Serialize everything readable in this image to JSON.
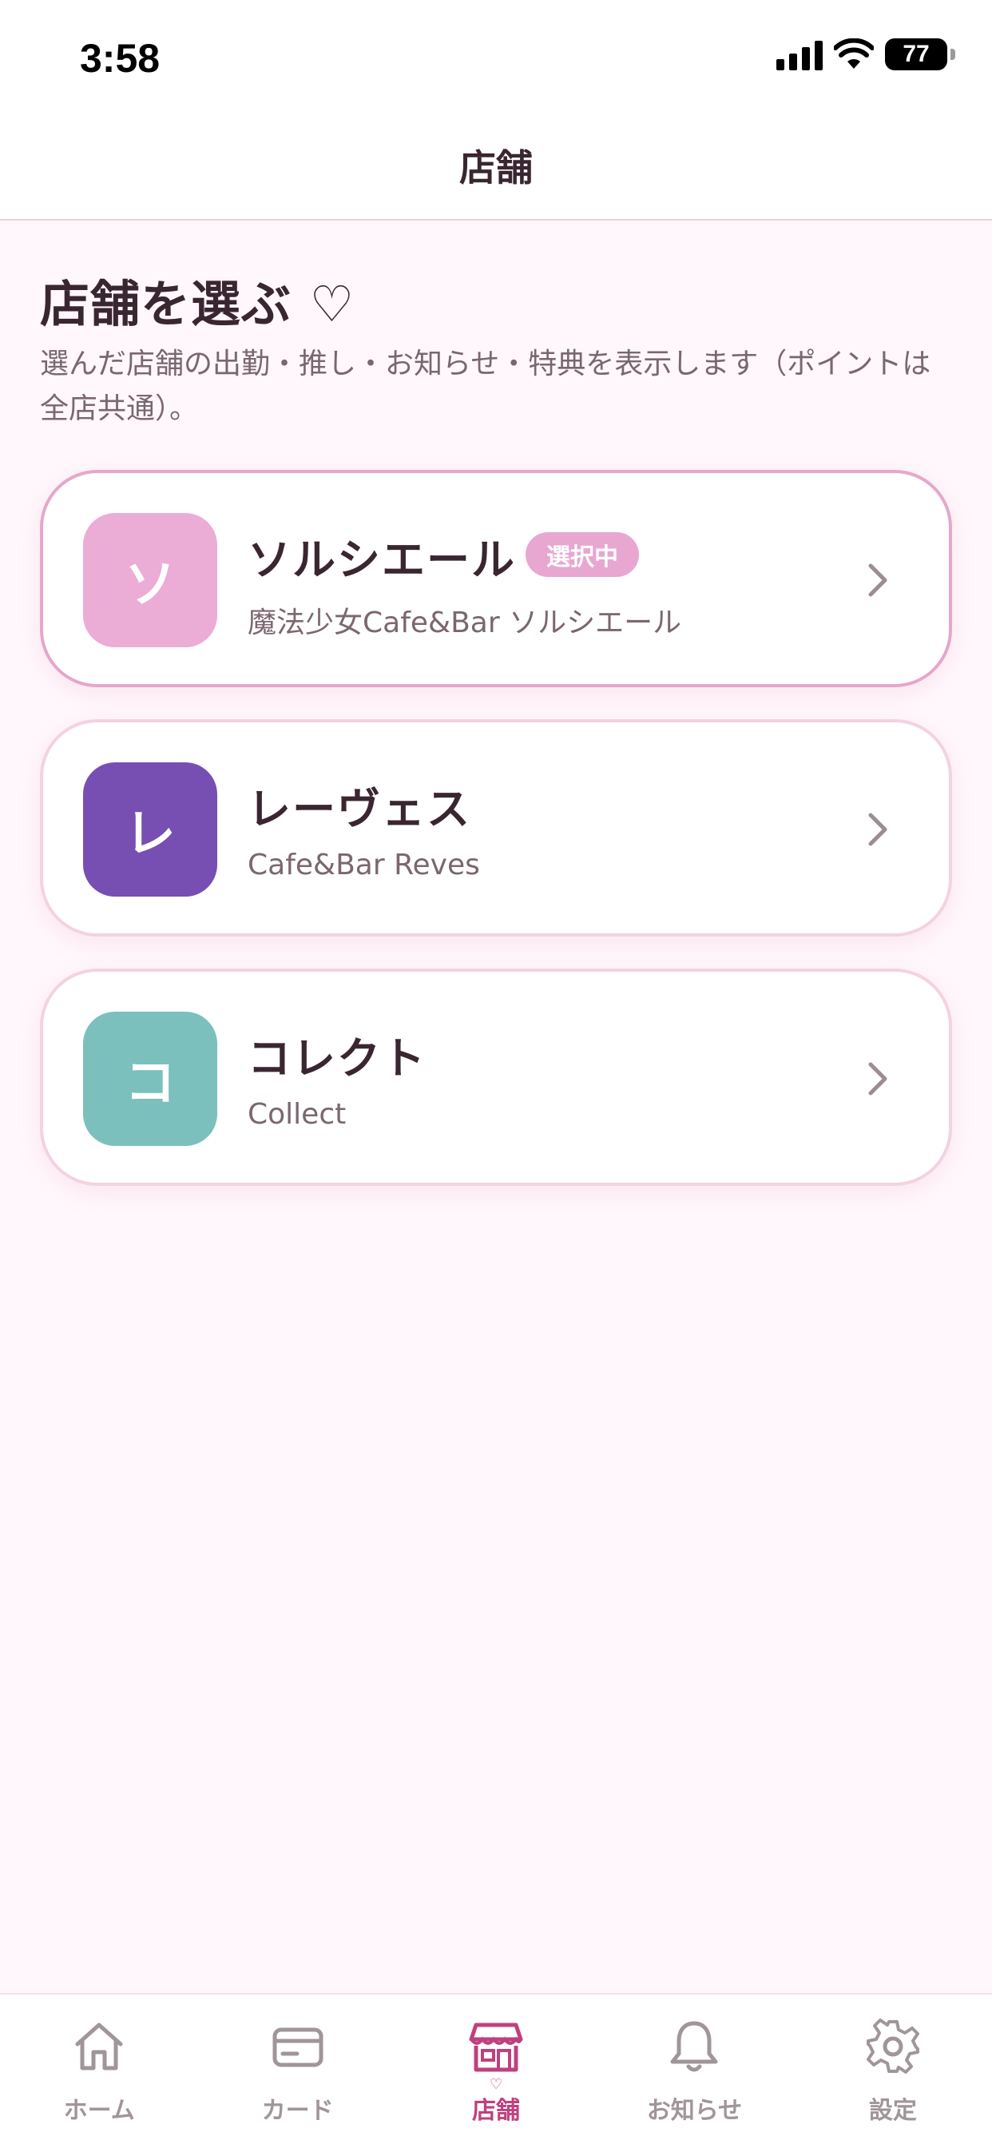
{
  "status_bar": {
    "time": "3:58",
    "battery": "77"
  },
  "header": {
    "title": "店舗"
  },
  "section": {
    "title": "店舗を選ぶ ♡",
    "description": "選んだ店舗の出勤・推し・お知らせ・特典を表示します（ポイントは全店共通）。"
  },
  "stores": [
    {
      "initial": "ソ",
      "name": "ソルシエール",
      "subtitle": "魔法少女Cafe&Bar ソルシエール",
      "badge": "選択中",
      "color": "#ebacd6"
    },
    {
      "initial": "レ",
      "name": "レーヴェス",
      "subtitle": "Cafe&Bar Reves",
      "color": "#774fb2"
    },
    {
      "initial": "コ",
      "name": "コレクト",
      "subtitle": "Collect",
      "color": "#7bc0bd"
    }
  ],
  "tabs": [
    {
      "label": "ホーム",
      "icon": "home-icon"
    },
    {
      "label": "カード",
      "icon": "card-icon"
    },
    {
      "label": "店舗",
      "icon": "store-icon",
      "active": true,
      "marker": "♡"
    },
    {
      "label": "お知らせ",
      "icon": "bell-icon"
    },
    {
      "label": "設定",
      "icon": "gear-icon"
    }
  ],
  "colors": {
    "accent": "#c0407e",
    "background": "#fff7fb",
    "text": "#3a2630",
    "muted": "#7b6670"
  }
}
